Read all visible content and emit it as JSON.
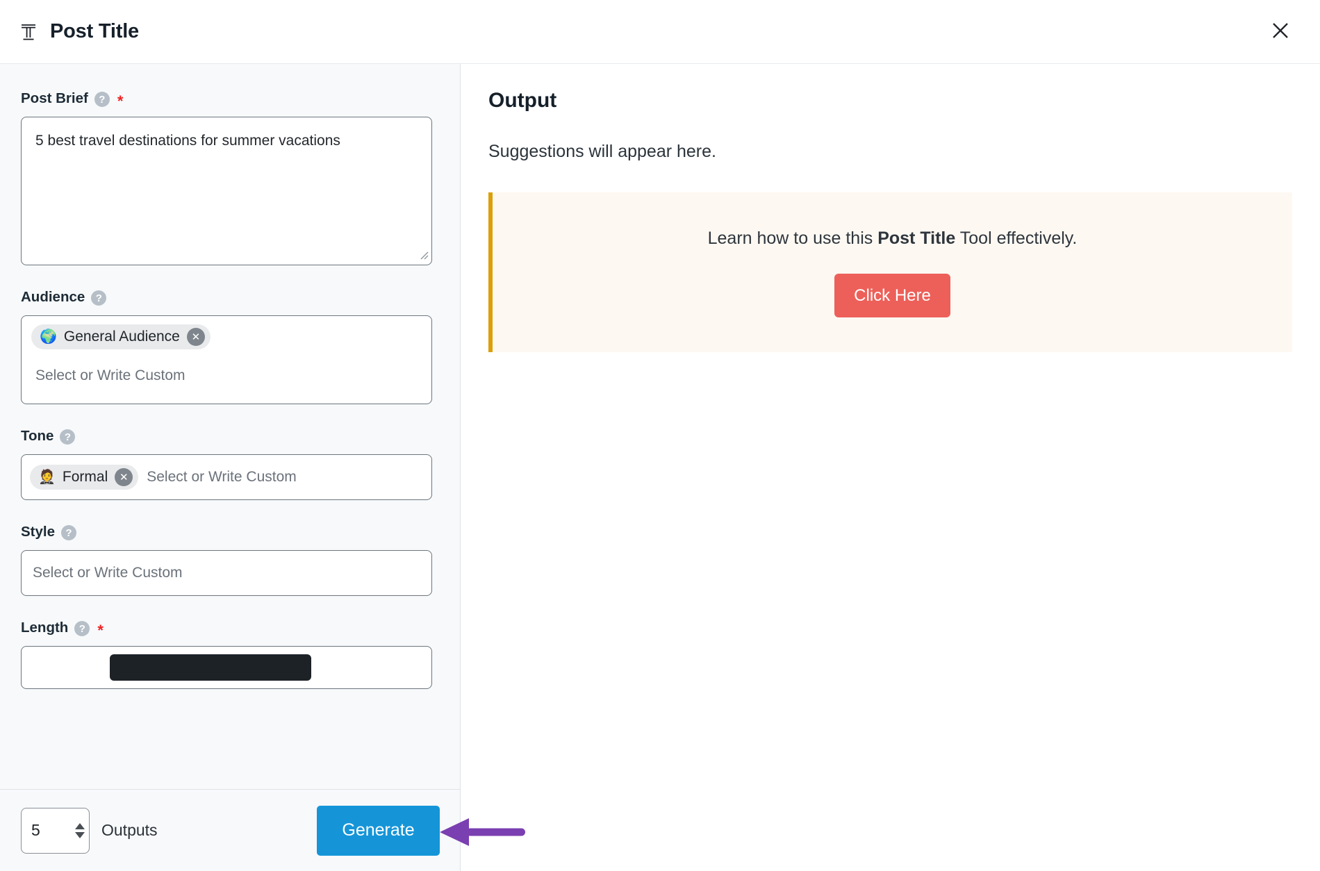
{
  "header": {
    "icon": "text-title-icon",
    "title": "Post Title",
    "close_icon": "close-icon"
  },
  "form": {
    "fields": [
      {
        "key": "post_brief",
        "label": "Post Brief",
        "help_icon": "question-mark-icon",
        "required": true,
        "required_marker": "*",
        "value": "5 best travel destinations for summer vacations",
        "placeholder": ""
      },
      {
        "key": "audience",
        "label": "Audience",
        "help_icon": "question-mark-icon",
        "required": false,
        "placeholder": "Select or Write Custom",
        "chips": [
          {
            "emoji": "🌍",
            "emoji_name": "earth-globe-icon",
            "label": "General Audience",
            "remove_icon": "remove-chip-icon"
          }
        ]
      },
      {
        "key": "tone",
        "label": "Tone",
        "help_icon": "question-mark-icon",
        "required": false,
        "placeholder": "Select or Write Custom",
        "chips": [
          {
            "emoji": "🤵",
            "emoji_name": "person-in-tuxedo-icon",
            "label": "Formal",
            "remove_icon": "remove-chip-icon"
          }
        ]
      },
      {
        "key": "style",
        "label": "Style",
        "help_icon": "question-mark-icon",
        "required": false,
        "placeholder": "Select or Write Custom",
        "chips": []
      },
      {
        "key": "length",
        "label": "Length",
        "help_icon": "question-mark-icon",
        "required": true,
        "required_marker": "*",
        "placeholder": "",
        "chips": []
      }
    ]
  },
  "footer": {
    "outputs_count": "5",
    "outputs_label": "Outputs",
    "stepper_up_icon": "stepper-up-arrow-icon",
    "stepper_down_icon": "stepper-down-arrow-icon",
    "generate_label": "Generate"
  },
  "output": {
    "title": "Output",
    "subtitle": "Suggestions will appear here.",
    "callout": {
      "text_before": "Learn how to use this ",
      "text_bold": "Post Title",
      "text_after": " Tool effectively.",
      "button_label": "Click Here"
    }
  },
  "annotation": {
    "arrow_name": "purple-pointer-arrow",
    "direction": "left",
    "color": "#7a3fb0",
    "points_to": "Generate"
  },
  "colors": {
    "accent_blue": "#1595d8",
    "callout_bg": "#fdf8f2",
    "callout_border": "#dd9f07",
    "callout_button": "#ed6059",
    "panel_bg": "#f7f9fa",
    "required_star": "#f02121",
    "annotation_purple": "#7a3fb0"
  }
}
